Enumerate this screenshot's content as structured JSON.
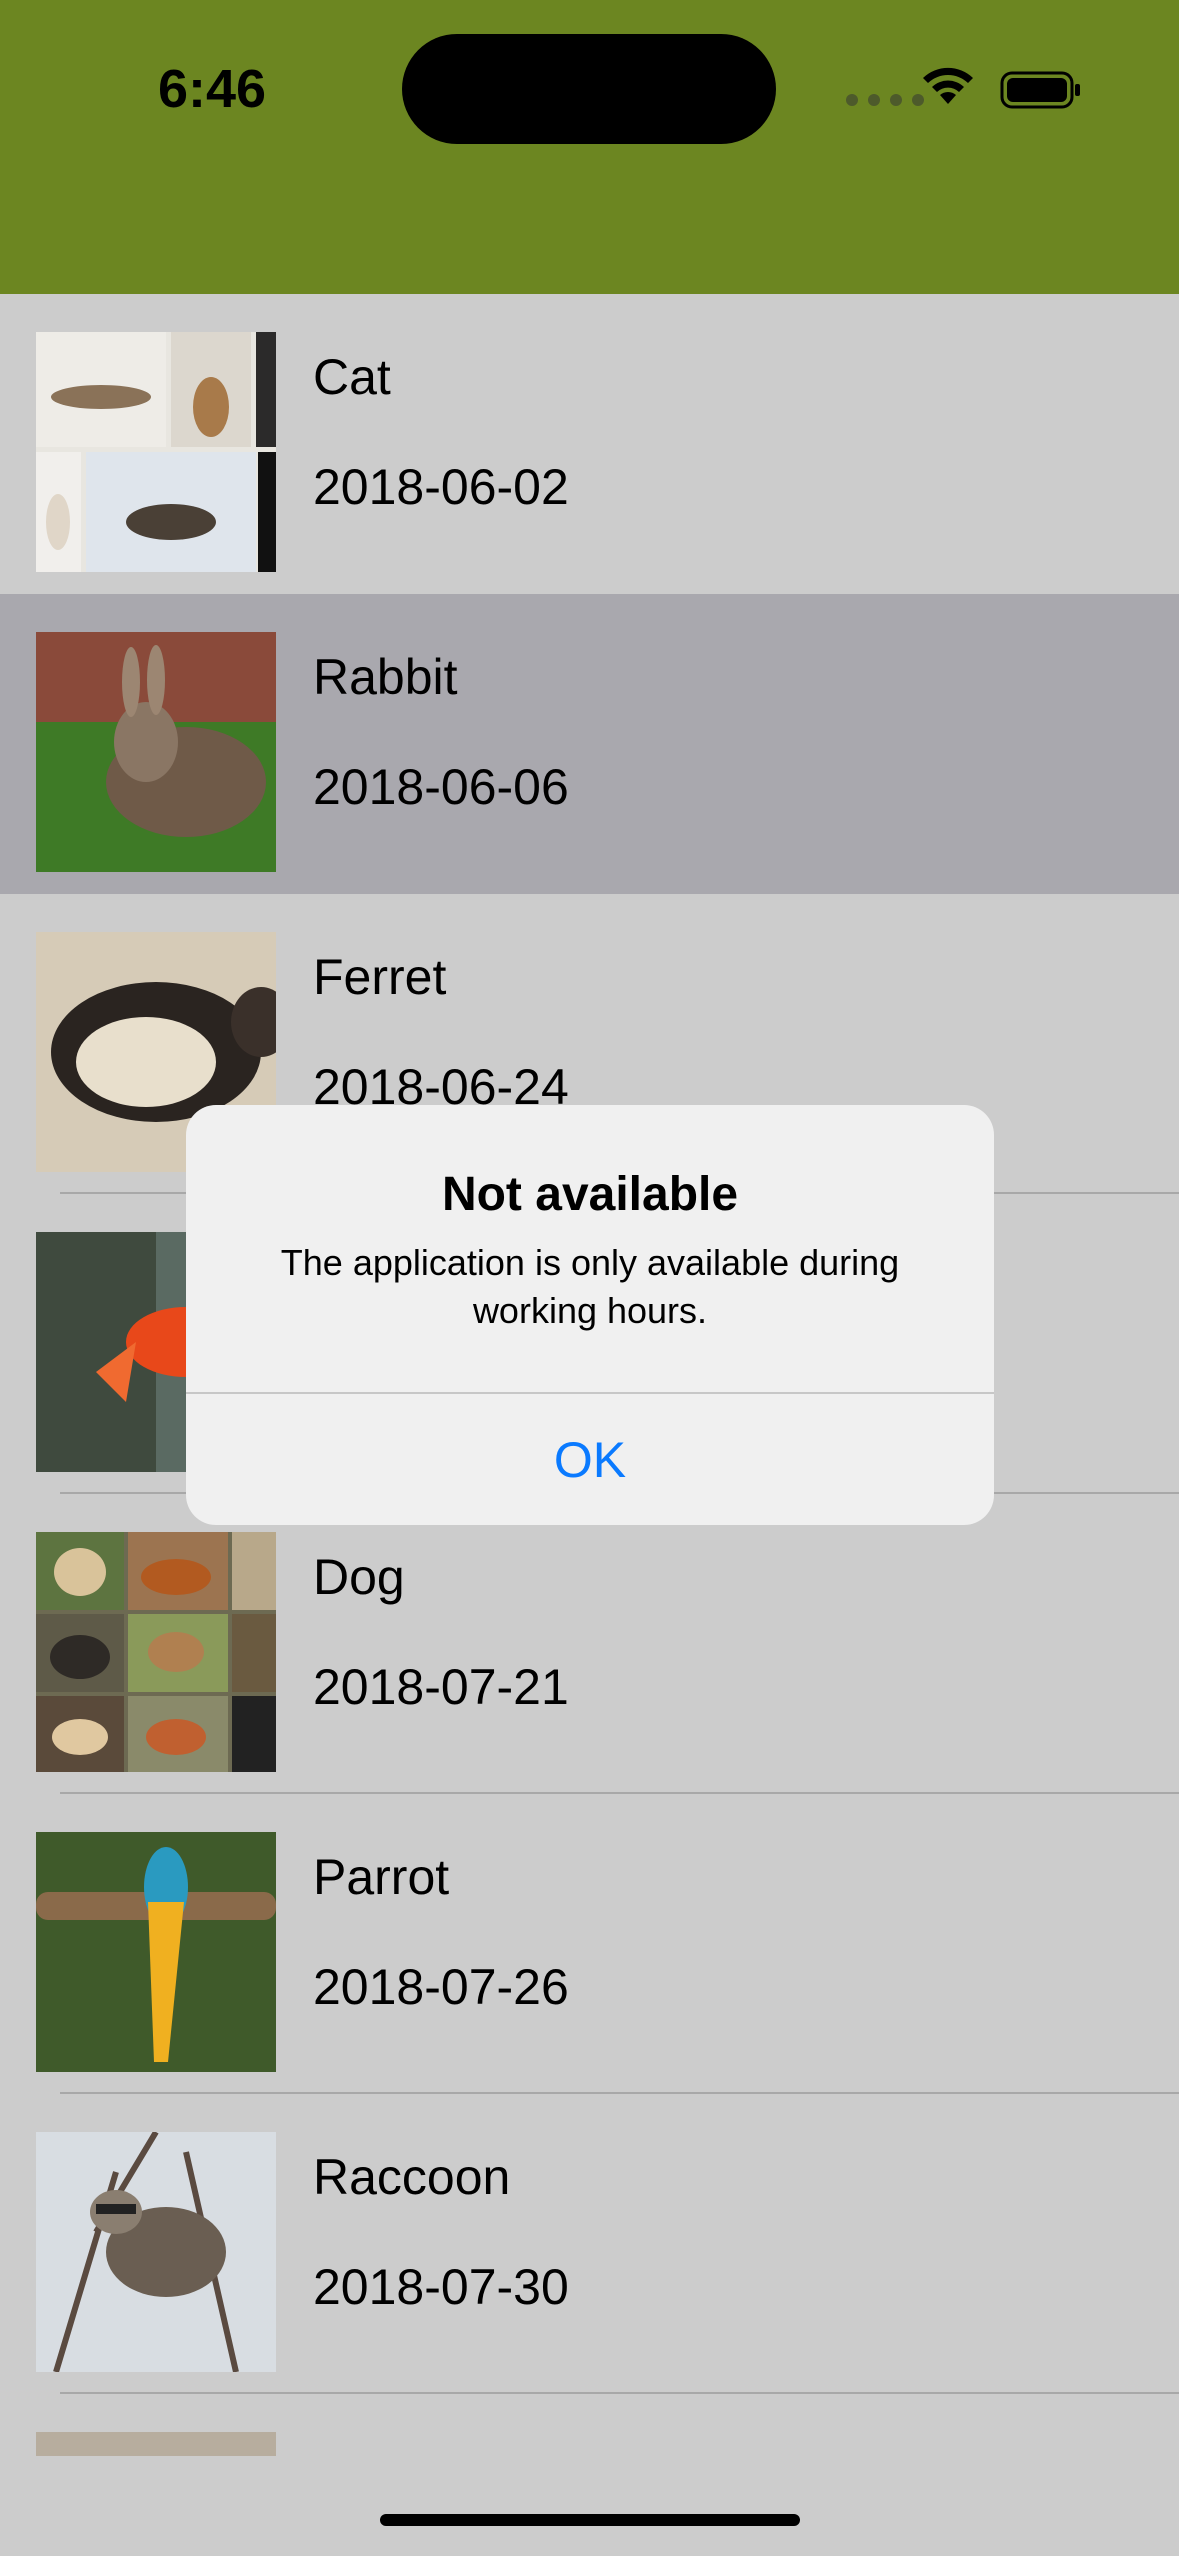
{
  "status_bar": {
    "time": "6:46",
    "bg_color": "#6c8621"
  },
  "list": {
    "items": [
      {
        "title": "Cat",
        "date": "2018-06-02",
        "thumb": "cat-collage"
      },
      {
        "title": "Rabbit",
        "date": "2018-06-06",
        "thumb": "rabbit",
        "selected": true
      },
      {
        "title": "Ferret",
        "date": "2018-06-24",
        "thumb": "ferret"
      },
      {
        "title": "",
        "date": "",
        "thumb": "goldfish"
      },
      {
        "title": "Dog",
        "date": "2018-07-21",
        "thumb": "dog-collage"
      },
      {
        "title": "Parrot",
        "date": "2018-07-26",
        "thumb": "parrot"
      },
      {
        "title": "Raccoon",
        "date": "2018-07-30",
        "thumb": "raccoon"
      }
    ]
  },
  "alert": {
    "title": "Not available",
    "message": "The application is only available during working hours.",
    "ok_label": "OK",
    "ok_color": "#0a7aff"
  }
}
